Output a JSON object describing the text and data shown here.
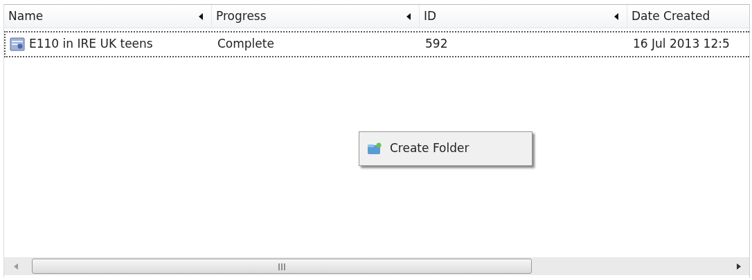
{
  "table": {
    "columns": [
      "Name",
      "Progress",
      "ID",
      "Date Created"
    ],
    "rows": [
      {
        "cells": [
          "E110 in IRE UK teens",
          "Complete",
          "592",
          "16 Jul 2013 12:5"
        ],
        "focused": true
      }
    ]
  },
  "context_menu": {
    "items": [
      "Create Folder"
    ]
  }
}
